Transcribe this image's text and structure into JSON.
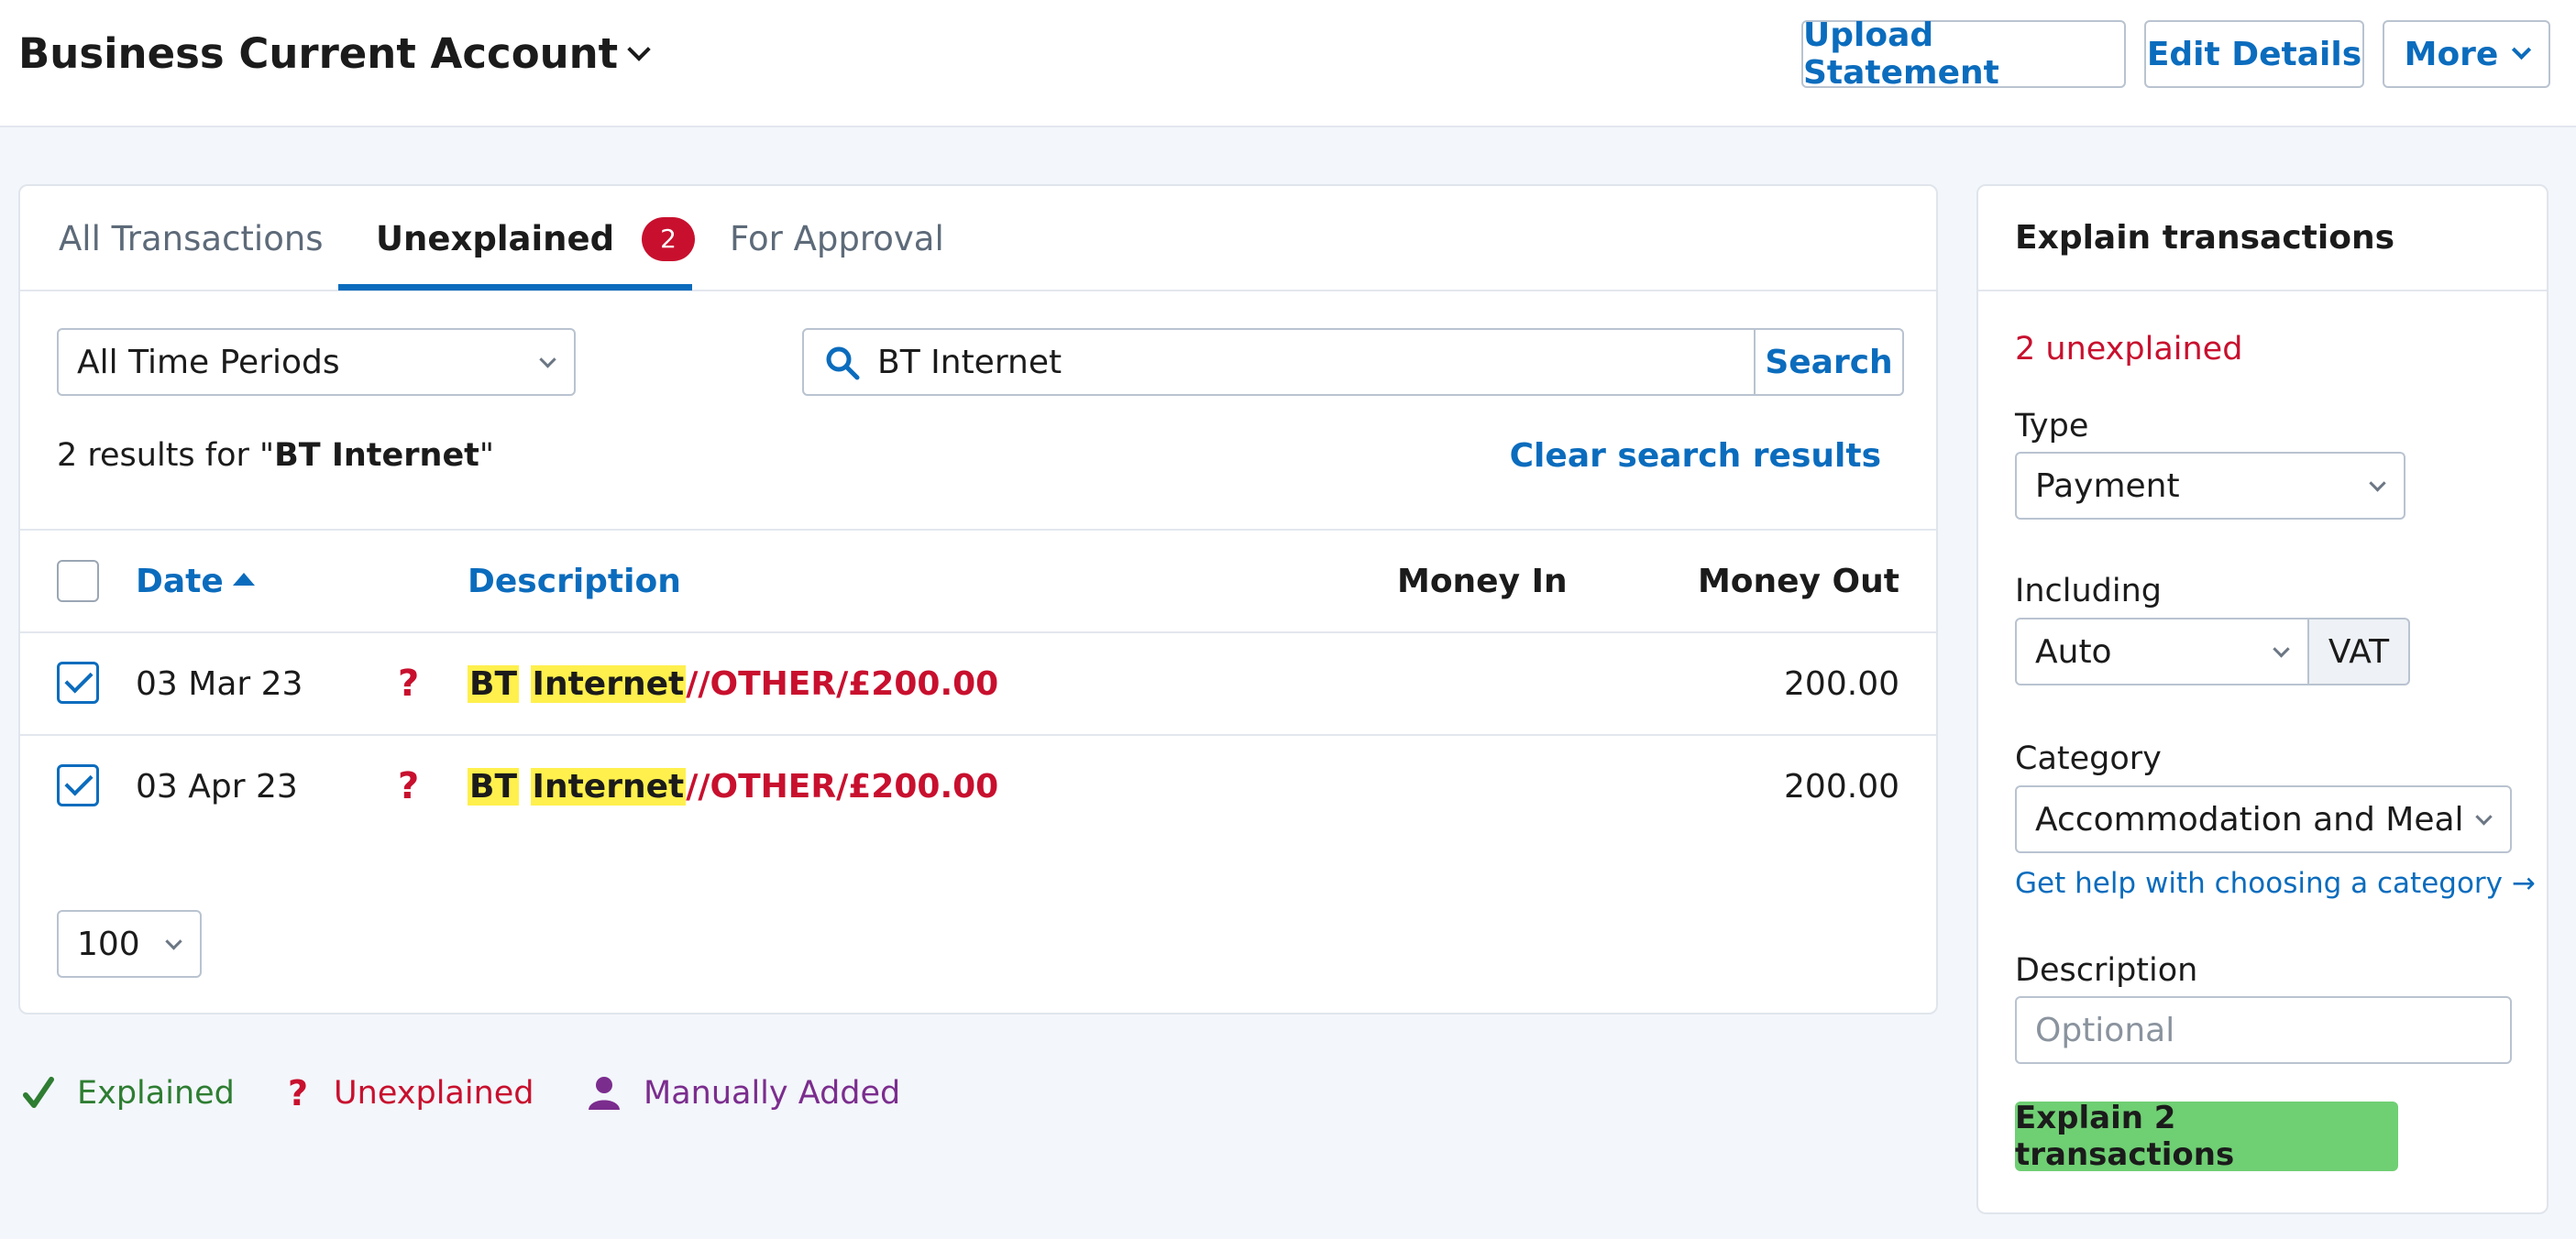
{
  "header": {
    "account_title": "Business Current Account",
    "upload_label": "Upload Statement",
    "edit_label": "Edit Details",
    "more_label": "More"
  },
  "tabs": [
    {
      "label": "All Transactions"
    },
    {
      "label": "Unexplained",
      "badge": "2"
    },
    {
      "label": "For Approval"
    }
  ],
  "filters": {
    "period": "All Time Periods",
    "search_value": "BT Internet",
    "search_button": "Search"
  },
  "results": {
    "prefix": "2 results for \"",
    "query": "BT Internet",
    "suffix": "\"",
    "clear_label": "Clear search results"
  },
  "table": {
    "columns": {
      "date": "Date",
      "description": "Description",
      "money_in": "Money In",
      "money_out": "Money Out"
    },
    "rows": [
      {
        "date": "03 Mar 23",
        "status": "?",
        "desc_hl1": "BT",
        "desc_hl2": "Internet",
        "desc_rest": "//OTHER/£200.00",
        "money_in": "",
        "money_out": "200.00"
      },
      {
        "date": "03 Apr 23",
        "status": "?",
        "desc_hl1": "BT",
        "desc_hl2": "Internet",
        "desc_rest": "//OTHER/£200.00",
        "money_in": "",
        "money_out": "200.00"
      }
    ]
  },
  "page_size": "100",
  "legend": {
    "explained": "Explained",
    "unexplained": "Unexplained",
    "manual": "Manually Added"
  },
  "explain_panel": {
    "title": "Explain transactions",
    "count_text": "2 unexplained",
    "type_label": "Type",
    "type_value": "Payment",
    "including_label": "Including",
    "including_value": "Auto",
    "vat_label": "VAT",
    "category_label": "Category",
    "category_value": "Accommodation and Meal",
    "help_link": "Get help with choosing a category →",
    "description_label": "Description",
    "description_placeholder": "Optional",
    "submit_label": "Explain 2 transactions"
  },
  "colors": {
    "link": "#0b6cbd",
    "alert": "#c8102e",
    "explained": "#2e7d32",
    "manual": "#7b2d8e",
    "highlight": "#fff04d",
    "submit": "#6fcf73"
  }
}
